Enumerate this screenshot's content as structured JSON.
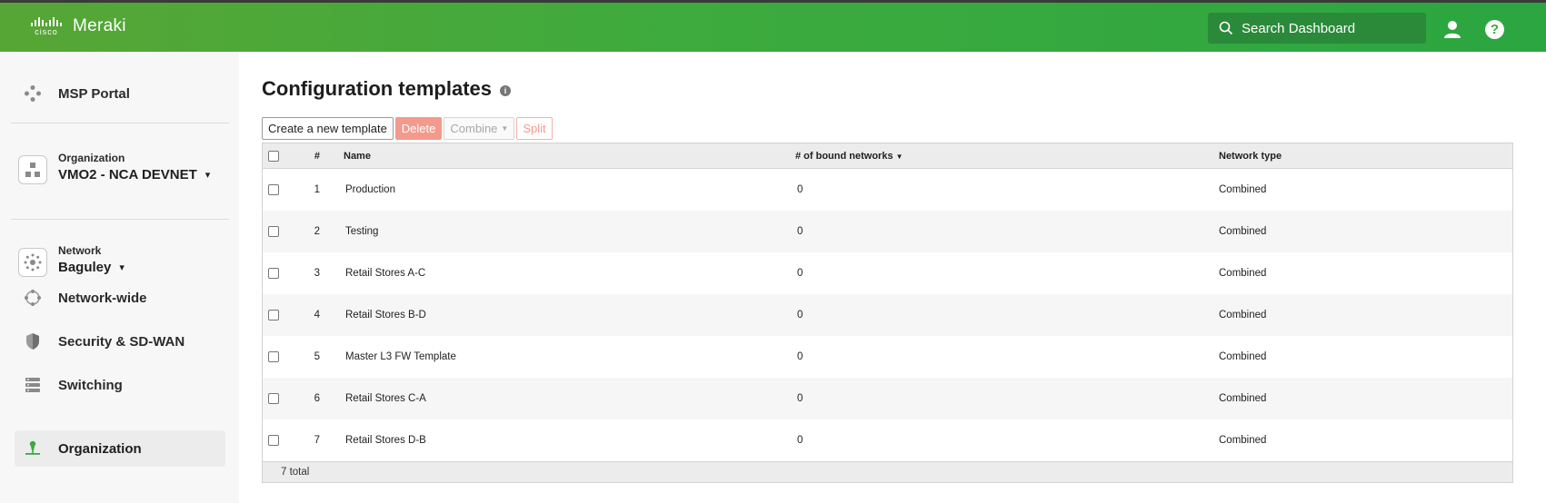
{
  "brand": {
    "cisco": "cisco",
    "name": "Meraki"
  },
  "header": {
    "search_placeholder": "Search Dashboard",
    "help": "?"
  },
  "sidebar": {
    "msp_portal": "MSP Portal",
    "org_caption": "Organization",
    "org_name": "VMO2 - NCA DEVNET",
    "network_caption": "Network",
    "network_name": "Baguley",
    "items": [
      {
        "label": "Network-wide",
        "icon": "network-wide-icon"
      },
      {
        "label": "Security & SD-WAN",
        "icon": "shield-icon"
      },
      {
        "label": "Switching",
        "icon": "switch-icon"
      },
      {
        "label": "Organization",
        "icon": "organization-icon",
        "active": true
      }
    ]
  },
  "page": {
    "title": "Configuration templates",
    "toolbar": {
      "create": "Create a new template",
      "delete": "Delete",
      "combine": "Combine",
      "split": "Split"
    },
    "table": {
      "headers": {
        "num": "#",
        "name": "Name",
        "bound": "# of bound networks",
        "type": "Network type"
      },
      "rows": [
        {
          "num": "1",
          "name": "Production",
          "bound": "0",
          "type": "Combined"
        },
        {
          "num": "2",
          "name": "Testing",
          "bound": "0",
          "type": "Combined"
        },
        {
          "num": "3",
          "name": "Retail Stores A-C",
          "bound": "0",
          "type": "Combined"
        },
        {
          "num": "4",
          "name": "Retail Stores B-D",
          "bound": "0",
          "type": "Combined"
        },
        {
          "num": "5",
          "name": "Master L3 FW Template",
          "bound": "0",
          "type": "Combined"
        },
        {
          "num": "6",
          "name": "Retail Stores C-A",
          "bound": "0",
          "type": "Combined"
        },
        {
          "num": "7",
          "name": "Retail Stores D-B",
          "bound": "0",
          "type": "Combined"
        }
      ],
      "footer": "7 total"
    }
  },
  "colors": {
    "brand_green": "#3dab3e",
    "delete_red": "#f39a8d"
  }
}
